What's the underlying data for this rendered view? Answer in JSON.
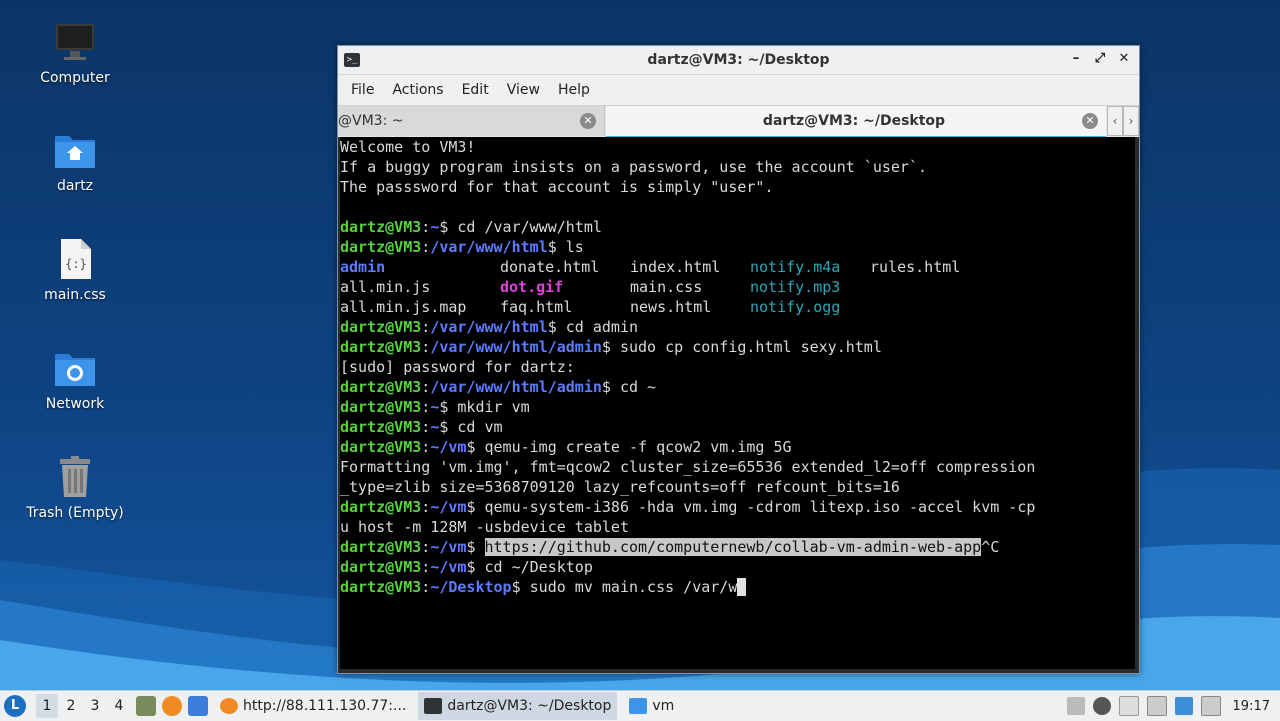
{
  "desktop": {
    "icons": [
      {
        "label": "Computer",
        "icon": "computer-icon"
      },
      {
        "label": "dartz",
        "icon": "home-folder-icon"
      },
      {
        "label": "main.css",
        "icon": "css-file-icon"
      },
      {
        "label": "Network",
        "icon": "network-folder-icon"
      },
      {
        "label": "Trash (Empty)",
        "icon": "trash-icon"
      }
    ]
  },
  "window": {
    "title": "dartz@VM3: ~/Desktop",
    "menu": [
      "File",
      "Actions",
      "Edit",
      "View",
      "Help"
    ],
    "tabs": [
      {
        "label": "@VM3: ~",
        "active": false
      },
      {
        "label": "dartz@VM3: ~/Desktop",
        "active": true
      }
    ],
    "controls": {
      "minimize": "–",
      "maximize": "⤢",
      "close": "✕"
    },
    "tab_nav": {
      "prev": "‹",
      "next": "›"
    }
  },
  "terminal": {
    "welcome": [
      "Welcome to VM3!",
      "If a buggy program insists on a password, use the account `user`.",
      "The passsword for that account is simply \"user\"."
    ],
    "prompt_user": "dartz@VM3",
    "ls_row1": [
      "admin",
      "donate.html",
      "index.html",
      "notify.m4a",
      "rules.html"
    ],
    "ls_row2": [
      "all.min.js",
      "dot.gif",
      "main.css",
      "notify.mp3"
    ],
    "ls_row3": [
      "all.min.js.map",
      "faq.html",
      "news.html",
      "notify.ogg"
    ],
    "cmd_cd_html": "cd /var/www/html",
    "cmd_ls": "ls",
    "cmd_cd_admin": "cd admin",
    "cmd_cp": "sudo cp config.html sexy.html",
    "sudo_prompt": "[sudo] password for dartz:",
    "cmd_cd_home": "cd ~",
    "cmd_mkdir": "mkdir vm",
    "cmd_cd_vm": "cd vm",
    "cmd_qemu_img": "qemu-img create -f qcow2 vm.img 5G",
    "out_format1": "Formatting 'vm.img', fmt=qcow2 cluster_size=65536 extended_l2=off compression",
    "out_format2": "_type=zlib size=5368709120 lazy_refcounts=off refcount_bits=16",
    "cmd_qemu_sys1": "qemu-system-i386 -hda vm.img -cdrom litexp.iso -accel kvm -cp",
    "cmd_qemu_sys2": "u host -m 128M -usbdevice tablet",
    "selected_url": "https://github.com/computernewb/collab-vm-admin-web-app",
    "ctrl_c": "^C",
    "cmd_cd_desktop": "cd ~/Desktop",
    "current_input": "sudo mv main.css /var/w",
    "paths": {
      "home": "~",
      "html": "/var/www/html",
      "admin": "/var/www/html/admin",
      "vm": "~/vm",
      "desktop": "~/Desktop"
    }
  },
  "taskbar": {
    "workspaces": [
      "1",
      "2",
      "3",
      "4"
    ],
    "active_workspace": "1",
    "tasks": [
      {
        "label": "http://88.111.130.77:...",
        "icon": "firefox-icon"
      },
      {
        "label": "dartz@VM3: ~/Desktop",
        "icon": "terminal-icon",
        "active": true
      },
      {
        "label": "vm",
        "icon": "folder-icon"
      }
    ],
    "clock": "19:17"
  },
  "colors": {
    "prompt_user": "#55d23a",
    "prompt_path": "#5c7cff",
    "image_file": "#e040e0",
    "audio_file": "#2aa6b8",
    "accent": "#3daee9"
  }
}
